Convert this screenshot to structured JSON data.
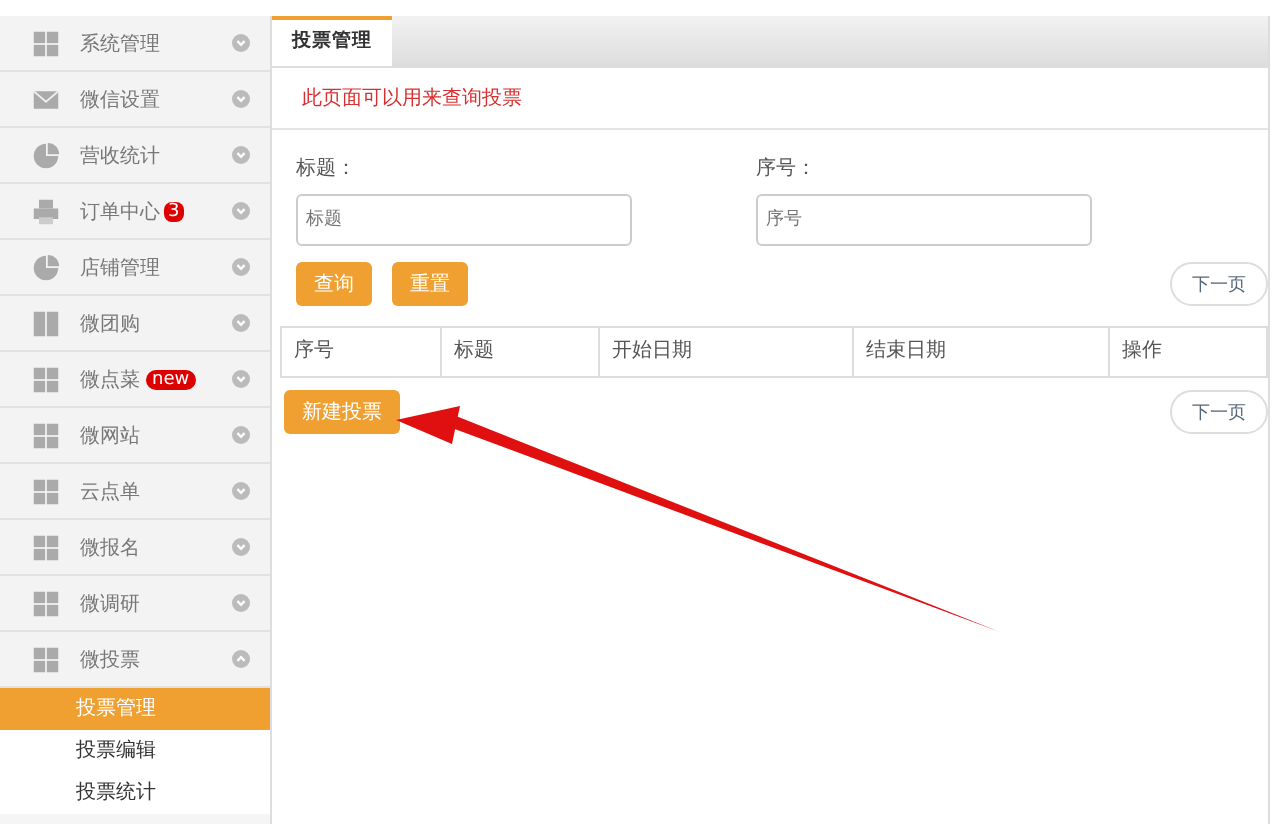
{
  "sidebar": {
    "items": [
      {
        "label": "系统管理",
        "kind": "grid"
      },
      {
        "label": "微信设置",
        "kind": "mail"
      },
      {
        "label": "营收统计",
        "kind": "pie"
      },
      {
        "label": "订单中心",
        "kind": "printer",
        "badge": "3"
      },
      {
        "label": "店铺管理",
        "kind": "pie"
      },
      {
        "label": "微团购",
        "kind": "columns"
      },
      {
        "label": "微点菜",
        "kind": "grid",
        "tag": "new"
      },
      {
        "label": "微网站",
        "kind": "grid"
      },
      {
        "label": "云点单",
        "kind": "grid"
      },
      {
        "label": "微报名",
        "kind": "grid"
      },
      {
        "label": "微调研",
        "kind": "grid"
      },
      {
        "label": "微投票",
        "kind": "grid",
        "expanded": true,
        "children": [
          {
            "label": "投票管理",
            "selected": true
          },
          {
            "label": "投票编辑",
            "selected": false
          },
          {
            "label": "投票统计",
            "selected": false
          }
        ]
      }
    ]
  },
  "tabs": [
    {
      "label": "投票管理",
      "selected": true
    }
  ],
  "notice": "此页面可以用来查询投票",
  "filters": [
    {
      "label": "标题：",
      "placeholder": "标题"
    },
    {
      "label": "序号：",
      "placeholder": "序号"
    }
  ],
  "buttons": [
    "查询",
    "重置"
  ],
  "pager_top": "下一页",
  "table": {
    "columns": [
      "序号",
      "标题",
      "开始日期",
      "结束日期",
      "操作"
    ]
  },
  "new_button": "新建投票",
  "pager_bottom": "下一页"
}
